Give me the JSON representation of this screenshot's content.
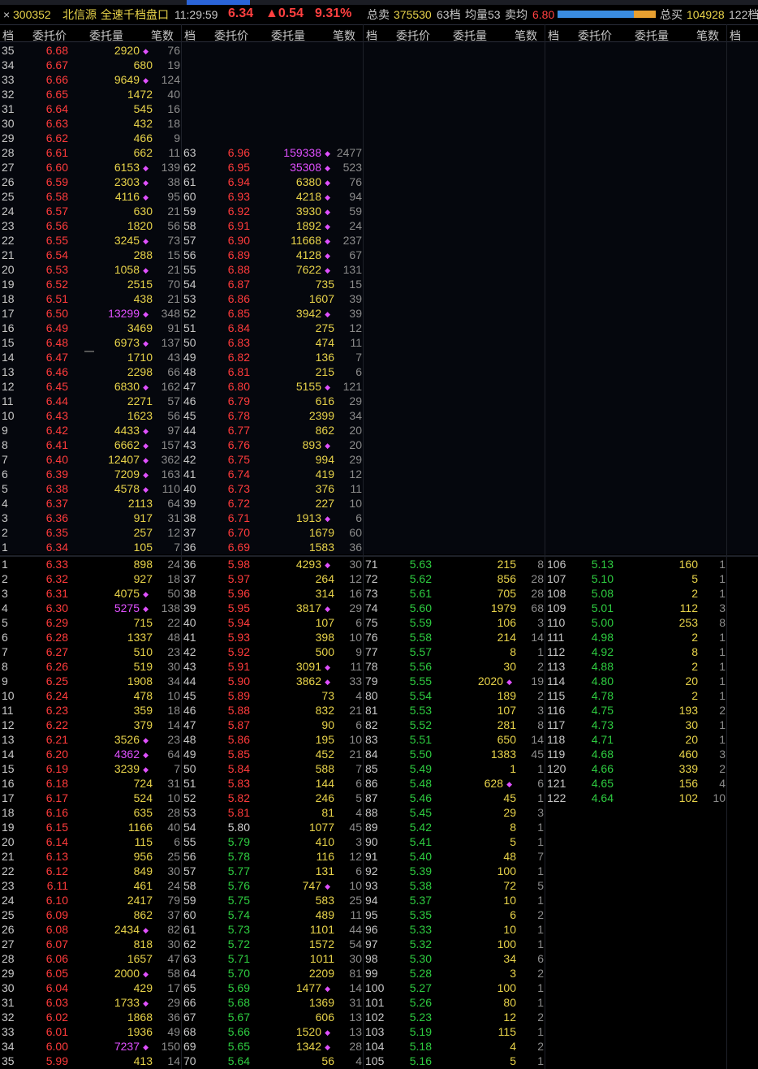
{
  "header": {
    "close": "×",
    "code": "300352",
    "name": "北信源",
    "title": "全速千档盘口",
    "time": "11:29:59",
    "price": "6.34",
    "change": "▲0.54",
    "pct": "9.31%",
    "ask_total_label": "总卖",
    "ask_total": "375530",
    "ask_levels": "63档",
    "avg_levels": "均量53",
    "avg_label": "卖均",
    "avg_value": "6.80",
    "bid_total_label": "总买",
    "bid_total": "104928",
    "bid_levels": "122档",
    "buy_ratio": 0.78
  },
  "columns": {
    "level": "档",
    "price": "委托价",
    "volume": "委托量",
    "count": "笔数"
  },
  "colors": {
    "up": "#ff3b3b",
    "down": "#2ecc40",
    "flat": "#d0d0d0",
    "volume": "#e8d34a",
    "large_volume": "#e050ff"
  },
  "ask_col1": [
    [
      "35",
      "6.68",
      "2920",
      "76",
      1,
      0
    ],
    [
      "34",
      "6.67",
      "680",
      "19",
      0,
      0
    ],
    [
      "33",
      "6.66",
      "9649",
      "124",
      1,
      0
    ],
    [
      "32",
      "6.65",
      "1472",
      "40",
      0,
      0
    ],
    [
      "31",
      "6.64",
      "545",
      "16",
      0,
      0
    ],
    [
      "30",
      "6.63",
      "432",
      "18",
      0,
      0
    ],
    [
      "29",
      "6.62",
      "466",
      "9",
      0,
      0
    ],
    [
      "28",
      "6.61",
      "662",
      "11",
      0,
      0
    ],
    [
      "27",
      "6.60",
      "6153",
      "139",
      1,
      0
    ],
    [
      "26",
      "6.59",
      "2303",
      "38",
      1,
      0
    ],
    [
      "25",
      "6.58",
      "4116",
      "95",
      1,
      0
    ],
    [
      "24",
      "6.57",
      "630",
      "21",
      0,
      0
    ],
    [
      "23",
      "6.56",
      "1820",
      "56",
      0,
      0
    ],
    [
      "22",
      "6.55",
      "3245",
      "73",
      1,
      0
    ],
    [
      "21",
      "6.54",
      "288",
      "15",
      0,
      0
    ],
    [
      "20",
      "6.53",
      "1058",
      "21",
      1,
      0
    ],
    [
      "19",
      "6.52",
      "2515",
      "70",
      0,
      0
    ],
    [
      "18",
      "6.51",
      "438",
      "21",
      0,
      0
    ],
    [
      "17",
      "6.50",
      "13299",
      "348",
      1,
      1
    ],
    [
      "16",
      "6.49",
      "3469",
      "91",
      0,
      0
    ],
    [
      "15",
      "6.48",
      "6973",
      "137",
      1,
      0
    ],
    [
      "14",
      "6.47",
      "1710",
      "43",
      0,
      0
    ],
    [
      "13",
      "6.46",
      "2298",
      "66",
      0,
      0
    ],
    [
      "12",
      "6.45",
      "6830",
      "162",
      1,
      0
    ],
    [
      "11",
      "6.44",
      "2271",
      "57",
      0,
      0
    ],
    [
      "10",
      "6.43",
      "1623",
      "56",
      0,
      0
    ],
    [
      "9",
      "6.42",
      "4433",
      "97",
      1,
      0
    ],
    [
      "8",
      "6.41",
      "6662",
      "157",
      1,
      0
    ],
    [
      "7",
      "6.40",
      "12407",
      "362",
      1,
      0
    ],
    [
      "6",
      "6.39",
      "7209",
      "163",
      1,
      0
    ],
    [
      "5",
      "6.38",
      "4578",
      "110",
      1,
      0
    ],
    [
      "4",
      "6.37",
      "2113",
      "64",
      0,
      0
    ],
    [
      "3",
      "6.36",
      "917",
      "31",
      0,
      0
    ],
    [
      "2",
      "6.35",
      "257",
      "12",
      0,
      0
    ],
    [
      "1",
      "6.34",
      "105",
      "7",
      0,
      0
    ]
  ],
  "ask_col2": [
    [
      "63",
      "6.96",
      "159338",
      "2477",
      1,
      1
    ],
    [
      "62",
      "6.95",
      "35308",
      "523",
      1,
      1
    ],
    [
      "61",
      "6.94",
      "6380",
      "76",
      1,
      0
    ],
    [
      "60",
      "6.93",
      "4218",
      "94",
      1,
      0
    ],
    [
      "59",
      "6.92",
      "3930",
      "59",
      1,
      0
    ],
    [
      "58",
      "6.91",
      "1892",
      "24",
      1,
      0
    ],
    [
      "57",
      "6.90",
      "11668",
      "237",
      1,
      0
    ],
    [
      "56",
      "6.89",
      "4128",
      "67",
      1,
      0
    ],
    [
      "55",
      "6.88",
      "7622",
      "131",
      1,
      0
    ],
    [
      "54",
      "6.87",
      "735",
      "15",
      0,
      0
    ],
    [
      "53",
      "6.86",
      "1607",
      "39",
      0,
      0
    ],
    [
      "52",
      "6.85",
      "3942",
      "39",
      1,
      0
    ],
    [
      "51",
      "6.84",
      "275",
      "12",
      0,
      0
    ],
    [
      "50",
      "6.83",
      "474",
      "11",
      0,
      0
    ],
    [
      "49",
      "6.82",
      "136",
      "7",
      0,
      0
    ],
    [
      "48",
      "6.81",
      "215",
      "6",
      0,
      0
    ],
    [
      "47",
      "6.80",
      "5155",
      "121",
      1,
      0
    ],
    [
      "46",
      "6.79",
      "616",
      "29",
      0,
      0
    ],
    [
      "45",
      "6.78",
      "2399",
      "34",
      0,
      0
    ],
    [
      "44",
      "6.77",
      "862",
      "20",
      0,
      0
    ],
    [
      "43",
      "6.76",
      "893",
      "20",
      1,
      0
    ],
    [
      "42",
      "6.75",
      "994",
      "29",
      0,
      0
    ],
    [
      "41",
      "6.74",
      "419",
      "12",
      0,
      0
    ],
    [
      "40",
      "6.73",
      "376",
      "11",
      0,
      0
    ],
    [
      "39",
      "6.72",
      "227",
      "10",
      0,
      0
    ],
    [
      "38",
      "6.71",
      "1913",
      "6",
      1,
      0
    ],
    [
      "37",
      "6.70",
      "1679",
      "60",
      0,
      0
    ],
    [
      "36",
      "6.69",
      "1583",
      "36",
      0,
      0
    ]
  ],
  "bid_col1": [
    [
      "1",
      "6.33",
      "898",
      "24",
      0,
      0
    ],
    [
      "2",
      "6.32",
      "927",
      "18",
      0,
      0
    ],
    [
      "3",
      "6.31",
      "4075",
      "50",
      1,
      0
    ],
    [
      "4",
      "6.30",
      "5275",
      "138",
      1,
      1
    ],
    [
      "5",
      "6.29",
      "715",
      "22",
      0,
      0
    ],
    [
      "6",
      "6.28",
      "1337",
      "48",
      0,
      0
    ],
    [
      "7",
      "6.27",
      "510",
      "23",
      0,
      0
    ],
    [
      "8",
      "6.26",
      "519",
      "30",
      0,
      0
    ],
    [
      "9",
      "6.25",
      "1908",
      "34",
      0,
      0
    ],
    [
      "10",
      "6.24",
      "478",
      "10",
      0,
      0
    ],
    [
      "11",
      "6.23",
      "359",
      "18",
      0,
      0
    ],
    [
      "12",
      "6.22",
      "379",
      "14",
      0,
      0
    ],
    [
      "13",
      "6.21",
      "3526",
      "23",
      1,
      0
    ],
    [
      "14",
      "6.20",
      "4362",
      "64",
      1,
      1
    ],
    [
      "15",
      "6.19",
      "3239",
      "7",
      1,
      0
    ],
    [
      "16",
      "6.18",
      "724",
      "31",
      0,
      0
    ],
    [
      "17",
      "6.17",
      "524",
      "10",
      0,
      0
    ],
    [
      "18",
      "6.16",
      "635",
      "28",
      0,
      0
    ],
    [
      "19",
      "6.15",
      "1166",
      "40",
      0,
      0
    ],
    [
      "20",
      "6.14",
      "115",
      "6",
      0,
      0
    ],
    [
      "21",
      "6.13",
      "956",
      "25",
      0,
      0
    ],
    [
      "22",
      "6.12",
      "849",
      "30",
      0,
      0
    ],
    [
      "23",
      "6.11",
      "461",
      "24",
      0,
      0
    ],
    [
      "24",
      "6.10",
      "2417",
      "79",
      0,
      0
    ],
    [
      "25",
      "6.09",
      "862",
      "37",
      0,
      0
    ],
    [
      "26",
      "6.08",
      "2434",
      "82",
      1,
      0
    ],
    [
      "27",
      "6.07",
      "818",
      "30",
      0,
      0
    ],
    [
      "28",
      "6.06",
      "1657",
      "47",
      0,
      0
    ],
    [
      "29",
      "6.05",
      "2000",
      "58",
      1,
      0
    ],
    [
      "30",
      "6.04",
      "429",
      "17",
      0,
      0
    ],
    [
      "31",
      "6.03",
      "1733",
      "29",
      1,
      0
    ],
    [
      "32",
      "6.02",
      "1868",
      "36",
      0,
      0
    ],
    [
      "33",
      "6.01",
      "1936",
      "49",
      0,
      0
    ],
    [
      "34",
      "6.00",
      "7237",
      "150",
      1,
      1
    ],
    [
      "35",
      "5.99",
      "413",
      "14",
      0,
      0
    ]
  ],
  "bid_col2": [
    [
      "36",
      "5.98",
      "4293",
      "30",
      1,
      0
    ],
    [
      "37",
      "5.97",
      "264",
      "12",
      0,
      0
    ],
    [
      "38",
      "5.96",
      "314",
      "16",
      0,
      0
    ],
    [
      "39",
      "5.95",
      "3817",
      "29",
      1,
      0
    ],
    [
      "40",
      "5.94",
      "107",
      "6",
      0,
      0
    ],
    [
      "41",
      "5.93",
      "398",
      "10",
      0,
      0
    ],
    [
      "42",
      "5.92",
      "500",
      "9",
      0,
      0
    ],
    [
      "43",
      "5.91",
      "3091",
      "11",
      1,
      0
    ],
    [
      "44",
      "5.90",
      "3862",
      "33",
      1,
      0
    ],
    [
      "45",
      "5.89",
      "73",
      "4",
      0,
      0
    ],
    [
      "46",
      "5.88",
      "832",
      "21",
      0,
      0
    ],
    [
      "47",
      "5.87",
      "90",
      "6",
      0,
      0
    ],
    [
      "48",
      "5.86",
      "195",
      "10",
      0,
      0
    ],
    [
      "49",
      "5.85",
      "452",
      "21",
      0,
      0
    ],
    [
      "50",
      "5.84",
      "588",
      "7",
      0,
      0
    ],
    [
      "51",
      "5.83",
      "144",
      "6",
      0,
      0
    ],
    [
      "52",
      "5.82",
      "246",
      "5",
      0,
      0
    ],
    [
      "53",
      "5.81",
      "81",
      "4",
      0,
      0
    ],
    [
      "54",
      "5.80",
      "1077",
      "45",
      0,
      0
    ],
    [
      "55",
      "5.79",
      "410",
      "3",
      0,
      0
    ],
    [
      "56",
      "5.78",
      "116",
      "12",
      0,
      0
    ],
    [
      "57",
      "5.77",
      "131",
      "6",
      0,
      0
    ],
    [
      "58",
      "5.76",
      "747",
      "10",
      1,
      0
    ],
    [
      "59",
      "5.75",
      "583",
      "25",
      0,
      0
    ],
    [
      "60",
      "5.74",
      "489",
      "11",
      0,
      0
    ],
    [
      "61",
      "5.73",
      "1101",
      "44",
      0,
      0
    ],
    [
      "62",
      "5.72",
      "1572",
      "54",
      0,
      0
    ],
    [
      "63",
      "5.71",
      "1011",
      "30",
      0,
      0
    ],
    [
      "64",
      "5.70",
      "2209",
      "81",
      0,
      0
    ],
    [
      "65",
      "5.69",
      "1477",
      "14",
      1,
      0
    ],
    [
      "66",
      "5.68",
      "1369",
      "31",
      0,
      0
    ],
    [
      "67",
      "5.67",
      "606",
      "13",
      0,
      0
    ],
    [
      "68",
      "5.66",
      "1520",
      "13",
      1,
      0
    ],
    [
      "69",
      "5.65",
      "1342",
      "28",
      1,
      0
    ],
    [
      "70",
      "5.64",
      "56",
      "4",
      0,
      0
    ]
  ],
  "bid_col3": [
    [
      "71",
      "5.63",
      "215",
      "8",
      0,
      0
    ],
    [
      "72",
      "5.62",
      "856",
      "28",
      0,
      0
    ],
    [
      "73",
      "5.61",
      "705",
      "28",
      0,
      0
    ],
    [
      "74",
      "5.60",
      "1979",
      "68",
      0,
      0
    ],
    [
      "75",
      "5.59",
      "106",
      "3",
      0,
      0
    ],
    [
      "76",
      "5.58",
      "214",
      "14",
      0,
      0
    ],
    [
      "77",
      "5.57",
      "8",
      "1",
      0,
      0
    ],
    [
      "78",
      "5.56",
      "30",
      "2",
      0,
      0
    ],
    [
      "79",
      "5.55",
      "2020",
      "19",
      1,
      0
    ],
    [
      "80",
      "5.54",
      "189",
      "2",
      0,
      0
    ],
    [
      "81",
      "5.53",
      "107",
      "3",
      0,
      0
    ],
    [
      "82",
      "5.52",
      "281",
      "8",
      0,
      0
    ],
    [
      "83",
      "5.51",
      "650",
      "14",
      0,
      0
    ],
    [
      "84",
      "5.50",
      "1383",
      "45",
      0,
      0
    ],
    [
      "85",
      "5.49",
      "1",
      "1",
      0,
      0
    ],
    [
      "86",
      "5.48",
      "628",
      "6",
      1,
      0
    ],
    [
      "87",
      "5.46",
      "45",
      "1",
      0,
      0
    ],
    [
      "88",
      "5.45",
      "29",
      "3",
      0,
      0
    ],
    [
      "89",
      "5.42",
      "8",
      "1",
      0,
      0
    ],
    [
      "90",
      "5.41",
      "5",
      "1",
      0,
      0
    ],
    [
      "91",
      "5.40",
      "48",
      "7",
      0,
      0
    ],
    [
      "92",
      "5.39",
      "100",
      "1",
      0,
      0
    ],
    [
      "93",
      "5.38",
      "72",
      "5",
      0,
      0
    ],
    [
      "94",
      "5.37",
      "10",
      "1",
      0,
      0
    ],
    [
      "95",
      "5.35",
      "6",
      "2",
      0,
      0
    ],
    [
      "96",
      "5.33",
      "10",
      "1",
      0,
      0
    ],
    [
      "97",
      "5.32",
      "100",
      "1",
      0,
      0
    ],
    [
      "98",
      "5.30",
      "34",
      "6",
      0,
      0
    ],
    [
      "99",
      "5.28",
      "3",
      "2",
      0,
      0
    ],
    [
      "100",
      "5.27",
      "100",
      "1",
      0,
      0
    ],
    [
      "101",
      "5.26",
      "80",
      "1",
      0,
      0
    ],
    [
      "102",
      "5.23",
      "12",
      "2",
      0,
      0
    ],
    [
      "103",
      "5.19",
      "115",
      "1",
      0,
      0
    ],
    [
      "104",
      "5.18",
      "4",
      "2",
      0,
      0
    ],
    [
      "105",
      "5.16",
      "5",
      "1",
      0,
      0
    ]
  ],
  "bid_col4": [
    [
      "106",
      "5.13",
      "160",
      "1",
      0,
      0
    ],
    [
      "107",
      "5.10",
      "5",
      "1",
      0,
      0
    ],
    [
      "108",
      "5.08",
      "2",
      "1",
      0,
      0
    ],
    [
      "109",
      "5.01",
      "112",
      "3",
      0,
      0
    ],
    [
      "110",
      "5.00",
      "253",
      "8",
      0,
      0
    ],
    [
      "111",
      "4.98",
      "2",
      "1",
      0,
      0
    ],
    [
      "112",
      "4.92",
      "8",
      "1",
      0,
      0
    ],
    [
      "113",
      "4.88",
      "2",
      "1",
      0,
      0
    ],
    [
      "114",
      "4.80",
      "20",
      "1",
      0,
      0
    ],
    [
      "115",
      "4.78",
      "2",
      "1",
      0,
      0
    ],
    [
      "116",
      "4.75",
      "193",
      "2",
      0,
      0
    ],
    [
      "117",
      "4.73",
      "30",
      "1",
      0,
      0
    ],
    [
      "118",
      "4.71",
      "20",
      "1",
      0,
      0
    ],
    [
      "119",
      "4.68",
      "460",
      "3",
      0,
      0
    ],
    [
      "120",
      "4.66",
      "339",
      "2",
      0,
      0
    ],
    [
      "121",
      "4.65",
      "156",
      "4",
      0,
      0
    ],
    [
      "122",
      "4.64",
      "102",
      "10",
      0,
      0
    ]
  ]
}
